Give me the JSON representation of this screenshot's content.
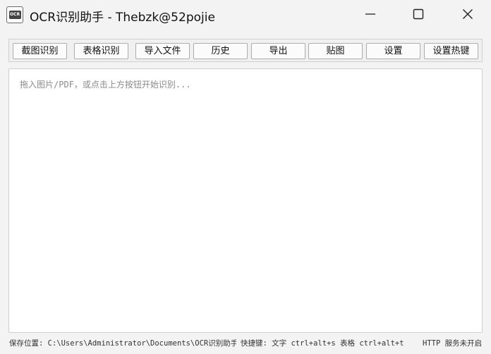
{
  "window": {
    "title": "OCR识别助手 - Thebzk@52pojie",
    "app_icon_text": "OCR",
    "minimize_icon": "minimize-icon",
    "maximize_icon": "maximize-icon",
    "close_icon": "close-icon"
  },
  "toolbar": {
    "buttons": [
      {
        "label": "截图识别"
      },
      {
        "label": "表格识别"
      },
      {
        "label": "导入文件"
      },
      {
        "label": "历史"
      },
      {
        "label": "导出"
      },
      {
        "label": "贴图"
      },
      {
        "label": "设置"
      },
      {
        "label": "设置热键"
      }
    ]
  },
  "editor": {
    "placeholder": "拖入图片/PDF，或点击上方按钮开始识别..."
  },
  "status": {
    "save_path": "保存位置: C:\\Users\\Administrator\\Documents\\OCR识别助手\\",
    "hotkeys": "快捷键: 文字 ctrl+alt+s  表格 ctrl+alt+t",
    "http": "HTTP 服务未开启"
  }
}
